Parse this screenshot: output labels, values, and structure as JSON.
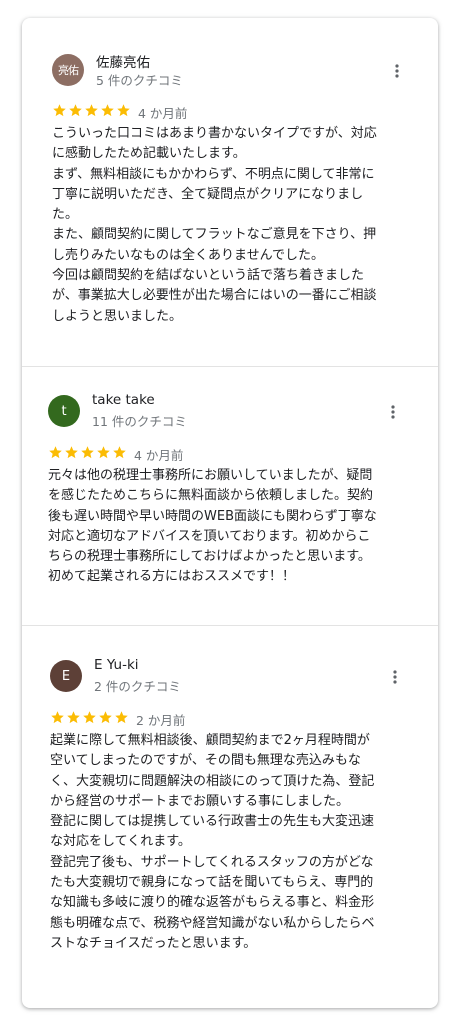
{
  "colors": {
    "star": "#fbbc04",
    "avatar_1": "#8d6e63",
    "avatar_2": "#33691e",
    "avatar_3": "#5d4037"
  },
  "reviews": [
    {
      "avatar_text": "亮佑",
      "author": "佐藤亮佑",
      "review_count": "5 件のクチコミ",
      "rating": 5,
      "date": "4 か月前",
      "lines": [
        "こういった口コミはあまり書かないタイプですが、対応",
        "に感動したため記載いたします。",
        "まず、無料相談にもかかわらず、不明点に関して非常に",
        "丁寧に説明いただき、全て疑問点がクリアになりまし",
        "た。",
        "また、顧問契約に関してフラットなご意見を下さり、押",
        "し売りみたいなものは全くありませんでした。",
        "今回は顧問契約を結ばないという話で落ち着きました",
        "が、事業拡大し必要性が出た場合にはいの一番にご相談",
        "しようと思いました。"
      ]
    },
    {
      "avatar_text": "t",
      "author": "take take",
      "review_count": "11 件のクチコミ",
      "rating": 5,
      "date": "4 か月前",
      "lines": [
        "元々は他の税理士事務所にお願いしていましたが、疑問",
        "を感じたためこちらに無料面談から依頼しました。契約",
        "後も遅い時間や早い時間のWEB面談にも関わらず丁寧な",
        "対応と適切なアドバイスを頂いております。初めからこ",
        "ちらの税理士事務所にしておけばよかったと思います。",
        "初めて起業される方にはおススメです！！"
      ]
    },
    {
      "avatar_text": "E",
      "author": "E Yu-ki",
      "review_count": "2 件のクチコミ",
      "rating": 5,
      "date": "2 か月前",
      "lines": [
        "起業に際して無料相談後、顧問契約まで2ヶ月程時間が",
        "空いてしまったのですが、その間も無理な売込みもな",
        "く、大変親切に問題解決の相談にのって頂けた為、登記",
        "から経営のサポートまでお願いする事にしました。",
        "登記に関しては提携している行政書士の先生も大変迅速",
        "な対応をしてくれます。",
        "登記完了後も、サポートしてくれるスタッフの方がどな",
        "たも大変親切で親身になって話を聞いてもらえ、専門的",
        "な知識も多岐に渡り的確な返答がもらえる事と、料金形",
        "態も明確な点で、税務や経営知識がない私からしたらベ",
        "ストなチョイスだったと思います。"
      ]
    }
  ]
}
